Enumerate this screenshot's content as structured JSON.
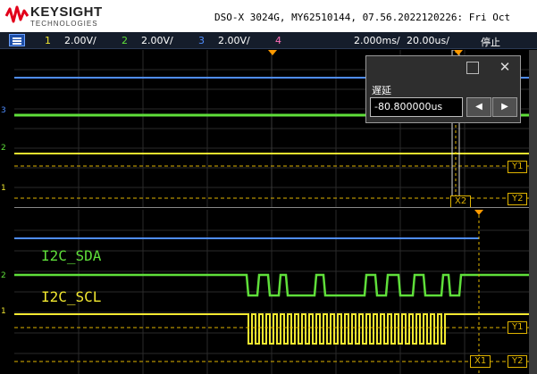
{
  "header": {
    "brand": "KEYSIGHT",
    "brand_sub": "TECHNOLOGIES",
    "device_info": "DSO-X 3024G, MY62510144, 07.56.2022120226: Fri Oct"
  },
  "channels": [
    {
      "num": "1",
      "scale": "2.00V/",
      "color": "#f2e830"
    },
    {
      "num": "2",
      "scale": "2.00V/",
      "color": "#5fdf3a"
    },
    {
      "num": "3",
      "scale": "2.00V/",
      "color": "#4f8dff"
    },
    {
      "num": "4",
      "scale": "",
      "color": "#ff6fb8"
    }
  ],
  "timebase": {
    "scale": "2.000ms/",
    "delay": "20.00us/",
    "state": "停止"
  },
  "popup": {
    "title": "遅延",
    "value": "-80.800000us",
    "left_arrow": "◀",
    "right_arrow": "▶",
    "close": "✕"
  },
  "labels": {
    "sda": "I2C_SDA",
    "scl": "I2C_SCL"
  },
  "cursor_tags": {
    "y1": "Y1",
    "y2": "Y2",
    "x1": "X1",
    "x2": "X2"
  },
  "colors": {
    "ch1": "#f2e830",
    "ch2": "#5fdf3a",
    "ch3": "#4f8dff",
    "cursor": "#e0b400",
    "trigger": "#ff9a00"
  },
  "icons": {
    "menu": "menu-icon",
    "doc": "document-icon",
    "close": "close-icon"
  }
}
